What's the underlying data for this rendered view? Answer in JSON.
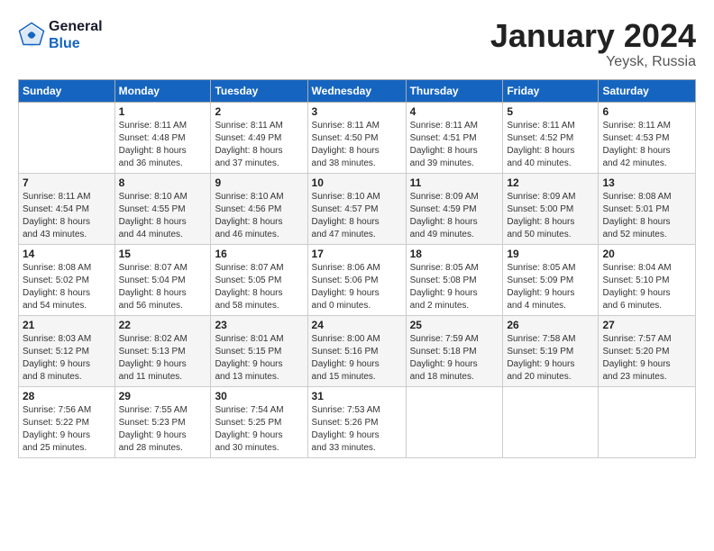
{
  "logo": {
    "line1": "General",
    "line2": "Blue"
  },
  "title": "January 2024",
  "subtitle": "Yeysk, Russia",
  "days_header": [
    "Sunday",
    "Monday",
    "Tuesday",
    "Wednesday",
    "Thursday",
    "Friday",
    "Saturday"
  ],
  "weeks": [
    [
      {
        "day": "",
        "info": ""
      },
      {
        "day": "1",
        "info": "Sunrise: 8:11 AM\nSunset: 4:48 PM\nDaylight: 8 hours\nand 36 minutes."
      },
      {
        "day": "2",
        "info": "Sunrise: 8:11 AM\nSunset: 4:49 PM\nDaylight: 8 hours\nand 37 minutes."
      },
      {
        "day": "3",
        "info": "Sunrise: 8:11 AM\nSunset: 4:50 PM\nDaylight: 8 hours\nand 38 minutes."
      },
      {
        "day": "4",
        "info": "Sunrise: 8:11 AM\nSunset: 4:51 PM\nDaylight: 8 hours\nand 39 minutes."
      },
      {
        "day": "5",
        "info": "Sunrise: 8:11 AM\nSunset: 4:52 PM\nDaylight: 8 hours\nand 40 minutes."
      },
      {
        "day": "6",
        "info": "Sunrise: 8:11 AM\nSunset: 4:53 PM\nDaylight: 8 hours\nand 42 minutes."
      }
    ],
    [
      {
        "day": "7",
        "info": "Sunrise: 8:11 AM\nSunset: 4:54 PM\nDaylight: 8 hours\nand 43 minutes."
      },
      {
        "day": "8",
        "info": "Sunrise: 8:10 AM\nSunset: 4:55 PM\nDaylight: 8 hours\nand 44 minutes."
      },
      {
        "day": "9",
        "info": "Sunrise: 8:10 AM\nSunset: 4:56 PM\nDaylight: 8 hours\nand 46 minutes."
      },
      {
        "day": "10",
        "info": "Sunrise: 8:10 AM\nSunset: 4:57 PM\nDaylight: 8 hours\nand 47 minutes."
      },
      {
        "day": "11",
        "info": "Sunrise: 8:09 AM\nSunset: 4:59 PM\nDaylight: 8 hours\nand 49 minutes."
      },
      {
        "day": "12",
        "info": "Sunrise: 8:09 AM\nSunset: 5:00 PM\nDaylight: 8 hours\nand 50 minutes."
      },
      {
        "day": "13",
        "info": "Sunrise: 8:08 AM\nSunset: 5:01 PM\nDaylight: 8 hours\nand 52 minutes."
      }
    ],
    [
      {
        "day": "14",
        "info": "Sunrise: 8:08 AM\nSunset: 5:02 PM\nDaylight: 8 hours\nand 54 minutes."
      },
      {
        "day": "15",
        "info": "Sunrise: 8:07 AM\nSunset: 5:04 PM\nDaylight: 8 hours\nand 56 minutes."
      },
      {
        "day": "16",
        "info": "Sunrise: 8:07 AM\nSunset: 5:05 PM\nDaylight: 8 hours\nand 58 minutes."
      },
      {
        "day": "17",
        "info": "Sunrise: 8:06 AM\nSunset: 5:06 PM\nDaylight: 9 hours\nand 0 minutes."
      },
      {
        "day": "18",
        "info": "Sunrise: 8:05 AM\nSunset: 5:08 PM\nDaylight: 9 hours\nand 2 minutes."
      },
      {
        "day": "19",
        "info": "Sunrise: 8:05 AM\nSunset: 5:09 PM\nDaylight: 9 hours\nand 4 minutes."
      },
      {
        "day": "20",
        "info": "Sunrise: 8:04 AM\nSunset: 5:10 PM\nDaylight: 9 hours\nand 6 minutes."
      }
    ],
    [
      {
        "day": "21",
        "info": "Sunrise: 8:03 AM\nSunset: 5:12 PM\nDaylight: 9 hours\nand 8 minutes."
      },
      {
        "day": "22",
        "info": "Sunrise: 8:02 AM\nSunset: 5:13 PM\nDaylight: 9 hours\nand 11 minutes."
      },
      {
        "day": "23",
        "info": "Sunrise: 8:01 AM\nSunset: 5:15 PM\nDaylight: 9 hours\nand 13 minutes."
      },
      {
        "day": "24",
        "info": "Sunrise: 8:00 AM\nSunset: 5:16 PM\nDaylight: 9 hours\nand 15 minutes."
      },
      {
        "day": "25",
        "info": "Sunrise: 7:59 AM\nSunset: 5:18 PM\nDaylight: 9 hours\nand 18 minutes."
      },
      {
        "day": "26",
        "info": "Sunrise: 7:58 AM\nSunset: 5:19 PM\nDaylight: 9 hours\nand 20 minutes."
      },
      {
        "day": "27",
        "info": "Sunrise: 7:57 AM\nSunset: 5:20 PM\nDaylight: 9 hours\nand 23 minutes."
      }
    ],
    [
      {
        "day": "28",
        "info": "Sunrise: 7:56 AM\nSunset: 5:22 PM\nDaylight: 9 hours\nand 25 minutes."
      },
      {
        "day": "29",
        "info": "Sunrise: 7:55 AM\nSunset: 5:23 PM\nDaylight: 9 hours\nand 28 minutes."
      },
      {
        "day": "30",
        "info": "Sunrise: 7:54 AM\nSunset: 5:25 PM\nDaylight: 9 hours\nand 30 minutes."
      },
      {
        "day": "31",
        "info": "Sunrise: 7:53 AM\nSunset: 5:26 PM\nDaylight: 9 hours\nand 33 minutes."
      },
      {
        "day": "",
        "info": ""
      },
      {
        "day": "",
        "info": ""
      },
      {
        "day": "",
        "info": ""
      }
    ]
  ]
}
